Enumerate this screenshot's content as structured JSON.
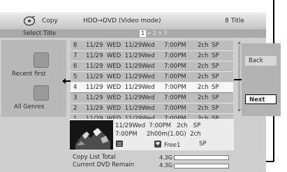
{
  "header": {
    "mode": "Copy",
    "route": "HDD→DVD (Video mode)",
    "title_count": "8  Title"
  },
  "subbar": {
    "label": "Select Title",
    "page_current": "1",
    "page_rest": "> 2 > 3"
  },
  "left_panel": {
    "sort_label": "Recent first",
    "genre_label": "All Genres"
  },
  "titles": [
    {
      "num": "8",
      "date": "11/29  WED  11/29Wed",
      "time": "7:00PM",
      "ch": "2ch",
      "mode": "SP"
    },
    {
      "num": "7",
      "date": "11/29  WED  11/29Wed",
      "time": "7:00PM",
      "ch": "2ch",
      "mode": "SP"
    },
    {
      "num": "6",
      "date": "11/29  WED  11/29Wed",
      "time": "7:00PM",
      "ch": "2ch",
      "mode": "SP"
    },
    {
      "num": "5",
      "date": "11/29  WED  11/29Wed",
      "time": "7:00PM",
      "ch": "2ch",
      "mode": "SP"
    },
    {
      "num": "4",
      "date": "11/29  WED  11/29Wed",
      "time": "7:00PM",
      "ch": "2ch",
      "mode": "SP"
    },
    {
      "num": "3",
      "date": "11/29  WED  11/29Wed",
      "time": "7:00PM",
      "ch": "2ch",
      "mode": "SP"
    },
    {
      "num": "2",
      "date": "11/29  WED  11/29Wed",
      "time": "7:00PM",
      "ch": "2ch",
      "mode": "SP"
    },
    {
      "num": "1",
      "date": "11/29  WED  11/29Wed",
      "time": "7:00PM",
      "ch": "2ch",
      "mode": "SP"
    }
  ],
  "selected_index": 4,
  "right_panel": {
    "back_label": "Back",
    "next_label": "Next"
  },
  "preview": {
    "line1": "11/29Wed  7:00PM   2ch   SP",
    "line2": "7:00PM     2h00m(1.0G)  2ch",
    "free_label": "Free1",
    "mode": "SP"
  },
  "footer": {
    "copy_total_label": "Copy List Total",
    "copy_total_value": "4.3G",
    "remain_label": "Current DVD Remain",
    "remain_value": "4.3G"
  }
}
